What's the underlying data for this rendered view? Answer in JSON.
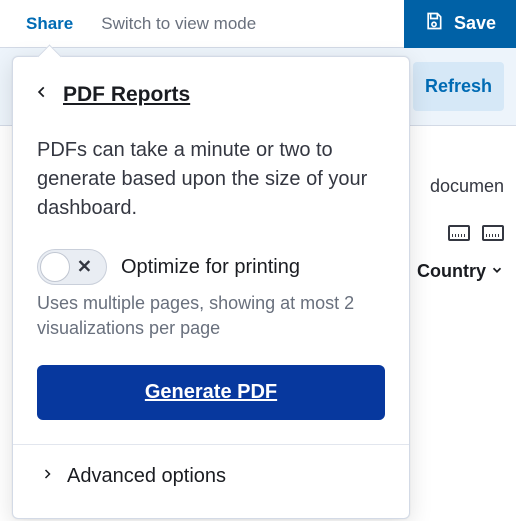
{
  "topbar": {
    "share": "Share",
    "view_mode": "Switch to view mode",
    "save": "Save"
  },
  "subbar": {
    "refresh": "Refresh"
  },
  "background": {
    "doc_text": "documen",
    "country_label": "Country"
  },
  "popover": {
    "title": "PDF Reports",
    "description": "PDFs can take a minute or two to generate based upon the size of your dashboard.",
    "toggle_label": "Optimize for printing",
    "toggle_help": "Uses multiple pages, showing at most 2 visualizations per page",
    "generate": "Generate PDF",
    "advanced": "Advanced options"
  }
}
